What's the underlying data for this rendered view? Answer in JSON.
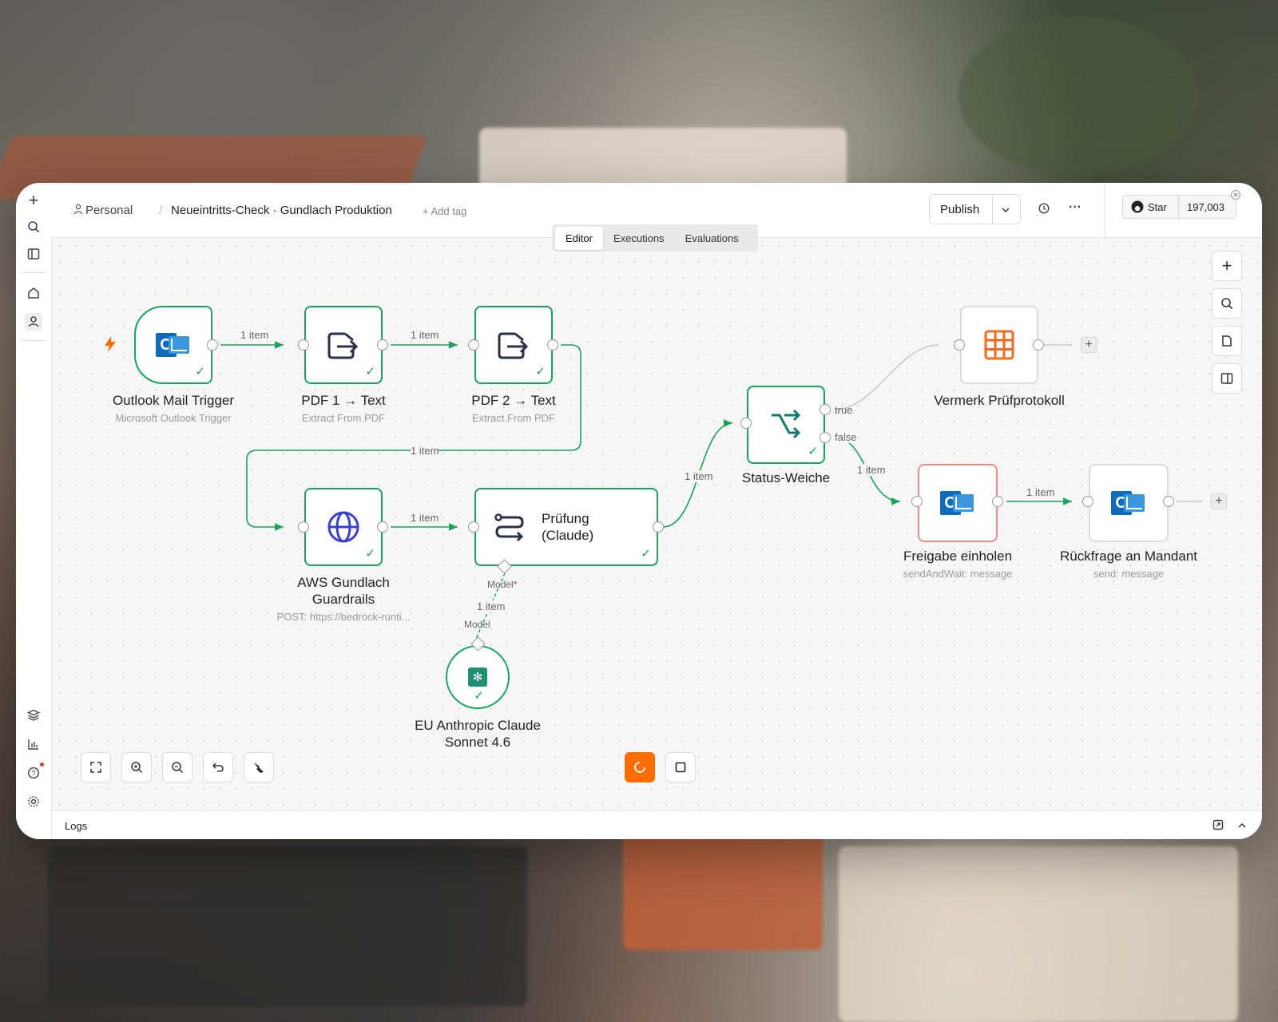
{
  "header": {
    "project": "Personal",
    "workflow_name": "Neueintritts-Check · Gundlach Produktion",
    "add_tag": "+ Add tag",
    "publish": "Publish",
    "more": "···",
    "star": "Star",
    "star_count": "197,003"
  },
  "tabs": [
    "Editor",
    "Executions",
    "Evaluations"
  ],
  "nodes": {
    "outlook_trigger": {
      "title": "Outlook Mail Trigger",
      "subtitle": "Microsoft Outlook Trigger"
    },
    "pdf1": {
      "title": "PDF 1 → Text",
      "subtitle": "Extract From PDF"
    },
    "pdf2": {
      "title": "PDF 2 → Text",
      "subtitle": "Extract From PDF"
    },
    "aws": {
      "title_line1": "AWS Gundlach",
      "title_line2": "Guardrails",
      "subtitle": "POST: https://bedrock-runti..."
    },
    "pruefung": {
      "title_line1": "Prüfung",
      "title_line2": "(Claude)"
    },
    "status": {
      "title": "Status-Weiche"
    },
    "vermerk": {
      "title": "Vermerk Prüfprotokoll"
    },
    "freigabe": {
      "title": "Freigabe einholen",
      "subtitle": "sendAndWait: message"
    },
    "rueckfrage": {
      "title": "Rückfrage an Mandant",
      "subtitle": "send: message"
    },
    "claude_model": {
      "title_line1": "EU Anthropic Claude",
      "title_line2": "Sonnet 4.6"
    }
  },
  "edges": {
    "item_label": "1 item",
    "true_label": "true",
    "false_label": "false",
    "model_label": "Model",
    "model_required": "*"
  },
  "logs": "Logs",
  "colors": {
    "success": "#1aa35a",
    "accent": "#ff6d00",
    "error_border": "#f28c82"
  }
}
